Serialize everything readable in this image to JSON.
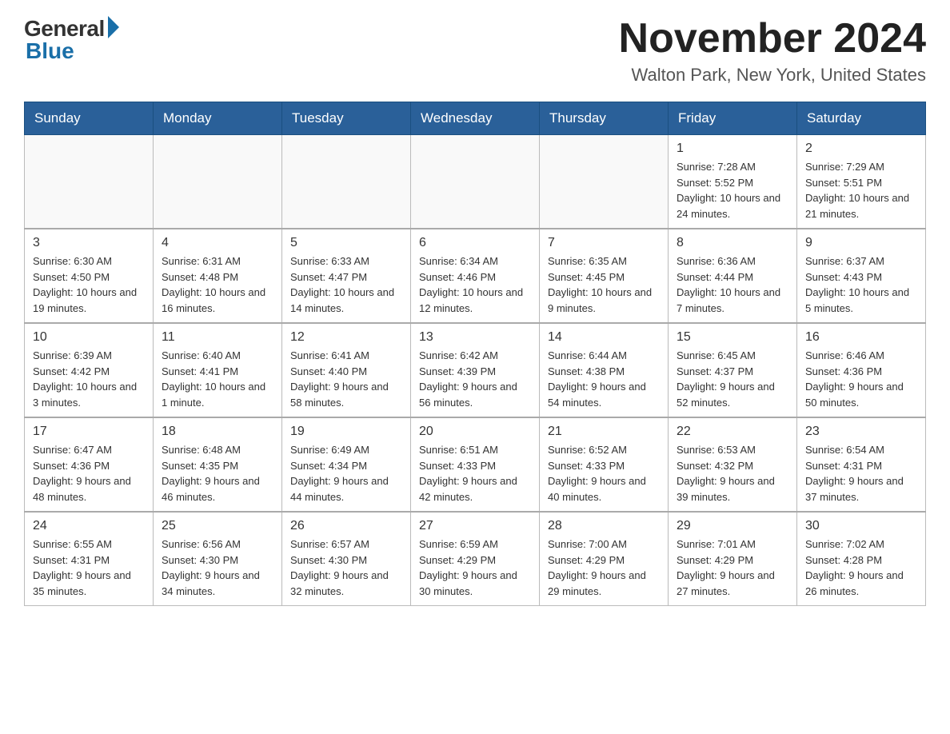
{
  "header": {
    "logo_general": "General",
    "logo_blue": "Blue",
    "month_title": "November 2024",
    "location": "Walton Park, New York, United States"
  },
  "days_of_week": [
    "Sunday",
    "Monday",
    "Tuesday",
    "Wednesday",
    "Thursday",
    "Friday",
    "Saturday"
  ],
  "weeks": [
    [
      {
        "day": "",
        "sunrise": "",
        "sunset": "",
        "daylight": ""
      },
      {
        "day": "",
        "sunrise": "",
        "sunset": "",
        "daylight": ""
      },
      {
        "day": "",
        "sunrise": "",
        "sunset": "",
        "daylight": ""
      },
      {
        "day": "",
        "sunrise": "",
        "sunset": "",
        "daylight": ""
      },
      {
        "day": "",
        "sunrise": "",
        "sunset": "",
        "daylight": ""
      },
      {
        "day": "1",
        "sunrise": "Sunrise: 7:28 AM",
        "sunset": "Sunset: 5:52 PM",
        "daylight": "Daylight: 10 hours and 24 minutes."
      },
      {
        "day": "2",
        "sunrise": "Sunrise: 7:29 AM",
        "sunset": "Sunset: 5:51 PM",
        "daylight": "Daylight: 10 hours and 21 minutes."
      }
    ],
    [
      {
        "day": "3",
        "sunrise": "Sunrise: 6:30 AM",
        "sunset": "Sunset: 4:50 PM",
        "daylight": "Daylight: 10 hours and 19 minutes."
      },
      {
        "day": "4",
        "sunrise": "Sunrise: 6:31 AM",
        "sunset": "Sunset: 4:48 PM",
        "daylight": "Daylight: 10 hours and 16 minutes."
      },
      {
        "day": "5",
        "sunrise": "Sunrise: 6:33 AM",
        "sunset": "Sunset: 4:47 PM",
        "daylight": "Daylight: 10 hours and 14 minutes."
      },
      {
        "day": "6",
        "sunrise": "Sunrise: 6:34 AM",
        "sunset": "Sunset: 4:46 PM",
        "daylight": "Daylight: 10 hours and 12 minutes."
      },
      {
        "day": "7",
        "sunrise": "Sunrise: 6:35 AM",
        "sunset": "Sunset: 4:45 PM",
        "daylight": "Daylight: 10 hours and 9 minutes."
      },
      {
        "day": "8",
        "sunrise": "Sunrise: 6:36 AM",
        "sunset": "Sunset: 4:44 PM",
        "daylight": "Daylight: 10 hours and 7 minutes."
      },
      {
        "day": "9",
        "sunrise": "Sunrise: 6:37 AM",
        "sunset": "Sunset: 4:43 PM",
        "daylight": "Daylight: 10 hours and 5 minutes."
      }
    ],
    [
      {
        "day": "10",
        "sunrise": "Sunrise: 6:39 AM",
        "sunset": "Sunset: 4:42 PM",
        "daylight": "Daylight: 10 hours and 3 minutes."
      },
      {
        "day": "11",
        "sunrise": "Sunrise: 6:40 AM",
        "sunset": "Sunset: 4:41 PM",
        "daylight": "Daylight: 10 hours and 1 minute."
      },
      {
        "day": "12",
        "sunrise": "Sunrise: 6:41 AM",
        "sunset": "Sunset: 4:40 PM",
        "daylight": "Daylight: 9 hours and 58 minutes."
      },
      {
        "day": "13",
        "sunrise": "Sunrise: 6:42 AM",
        "sunset": "Sunset: 4:39 PM",
        "daylight": "Daylight: 9 hours and 56 minutes."
      },
      {
        "day": "14",
        "sunrise": "Sunrise: 6:44 AM",
        "sunset": "Sunset: 4:38 PM",
        "daylight": "Daylight: 9 hours and 54 minutes."
      },
      {
        "day": "15",
        "sunrise": "Sunrise: 6:45 AM",
        "sunset": "Sunset: 4:37 PM",
        "daylight": "Daylight: 9 hours and 52 minutes."
      },
      {
        "day": "16",
        "sunrise": "Sunrise: 6:46 AM",
        "sunset": "Sunset: 4:36 PM",
        "daylight": "Daylight: 9 hours and 50 minutes."
      }
    ],
    [
      {
        "day": "17",
        "sunrise": "Sunrise: 6:47 AM",
        "sunset": "Sunset: 4:36 PM",
        "daylight": "Daylight: 9 hours and 48 minutes."
      },
      {
        "day": "18",
        "sunrise": "Sunrise: 6:48 AM",
        "sunset": "Sunset: 4:35 PM",
        "daylight": "Daylight: 9 hours and 46 minutes."
      },
      {
        "day": "19",
        "sunrise": "Sunrise: 6:49 AM",
        "sunset": "Sunset: 4:34 PM",
        "daylight": "Daylight: 9 hours and 44 minutes."
      },
      {
        "day": "20",
        "sunrise": "Sunrise: 6:51 AM",
        "sunset": "Sunset: 4:33 PM",
        "daylight": "Daylight: 9 hours and 42 minutes."
      },
      {
        "day": "21",
        "sunrise": "Sunrise: 6:52 AM",
        "sunset": "Sunset: 4:33 PM",
        "daylight": "Daylight: 9 hours and 40 minutes."
      },
      {
        "day": "22",
        "sunrise": "Sunrise: 6:53 AM",
        "sunset": "Sunset: 4:32 PM",
        "daylight": "Daylight: 9 hours and 39 minutes."
      },
      {
        "day": "23",
        "sunrise": "Sunrise: 6:54 AM",
        "sunset": "Sunset: 4:31 PM",
        "daylight": "Daylight: 9 hours and 37 minutes."
      }
    ],
    [
      {
        "day": "24",
        "sunrise": "Sunrise: 6:55 AM",
        "sunset": "Sunset: 4:31 PM",
        "daylight": "Daylight: 9 hours and 35 minutes."
      },
      {
        "day": "25",
        "sunrise": "Sunrise: 6:56 AM",
        "sunset": "Sunset: 4:30 PM",
        "daylight": "Daylight: 9 hours and 34 minutes."
      },
      {
        "day": "26",
        "sunrise": "Sunrise: 6:57 AM",
        "sunset": "Sunset: 4:30 PM",
        "daylight": "Daylight: 9 hours and 32 minutes."
      },
      {
        "day": "27",
        "sunrise": "Sunrise: 6:59 AM",
        "sunset": "Sunset: 4:29 PM",
        "daylight": "Daylight: 9 hours and 30 minutes."
      },
      {
        "day": "28",
        "sunrise": "Sunrise: 7:00 AM",
        "sunset": "Sunset: 4:29 PM",
        "daylight": "Daylight: 9 hours and 29 minutes."
      },
      {
        "day": "29",
        "sunrise": "Sunrise: 7:01 AM",
        "sunset": "Sunset: 4:29 PM",
        "daylight": "Daylight: 9 hours and 27 minutes."
      },
      {
        "day": "30",
        "sunrise": "Sunrise: 7:02 AM",
        "sunset": "Sunset: 4:28 PM",
        "daylight": "Daylight: 9 hours and 26 minutes."
      }
    ]
  ]
}
